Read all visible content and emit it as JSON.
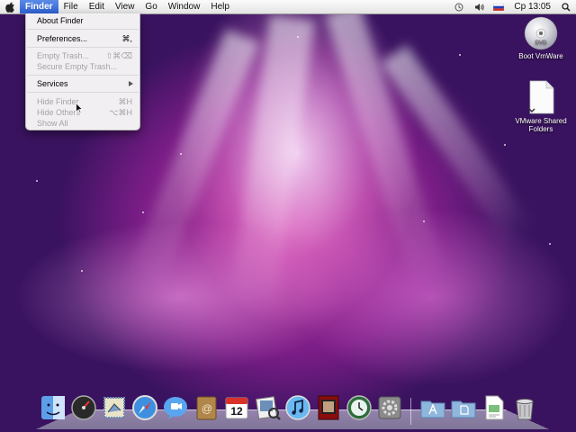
{
  "menubar": {
    "items": [
      "Finder",
      "File",
      "Edit",
      "View",
      "Go",
      "Window",
      "Help"
    ],
    "clock": "Ср 13:05"
  },
  "finder_menu": {
    "items": [
      {
        "label": "About Finder",
        "shortcut": "",
        "enabled": true
      },
      {
        "label": "Preferences...",
        "shortcut": "⌘,",
        "enabled": true
      },
      {
        "label": "Empty Trash...",
        "shortcut": "⇧⌘⌫",
        "enabled": false
      },
      {
        "label": "Secure Empty Trash...",
        "shortcut": "",
        "enabled": false
      },
      {
        "label": "Services",
        "shortcut": "",
        "enabled": true,
        "submenu": true
      },
      {
        "label": "Hide Finder",
        "shortcut": "⌘H",
        "enabled": false
      },
      {
        "label": "Hide Others",
        "shortcut": "⌥⌘H",
        "enabled": false
      },
      {
        "label": "Show All",
        "shortcut": "",
        "enabled": false
      }
    ]
  },
  "desktop_icons": [
    {
      "label": "Boot VmWare",
      "icon": "dvd-disc-icon"
    },
    {
      "label": "VMware Shared Folders",
      "icon": "shared-folder-icon"
    }
  ],
  "dock": {
    "calendar_day": "12",
    "apps": [
      "finder",
      "dashboard",
      "mail",
      "safari",
      "ichat",
      "address-book",
      "ical",
      "preview",
      "itunes",
      "photo-booth",
      "time-machine",
      "system-preferences",
      "applications-folder",
      "documents-folder",
      "document",
      "trash"
    ]
  }
}
